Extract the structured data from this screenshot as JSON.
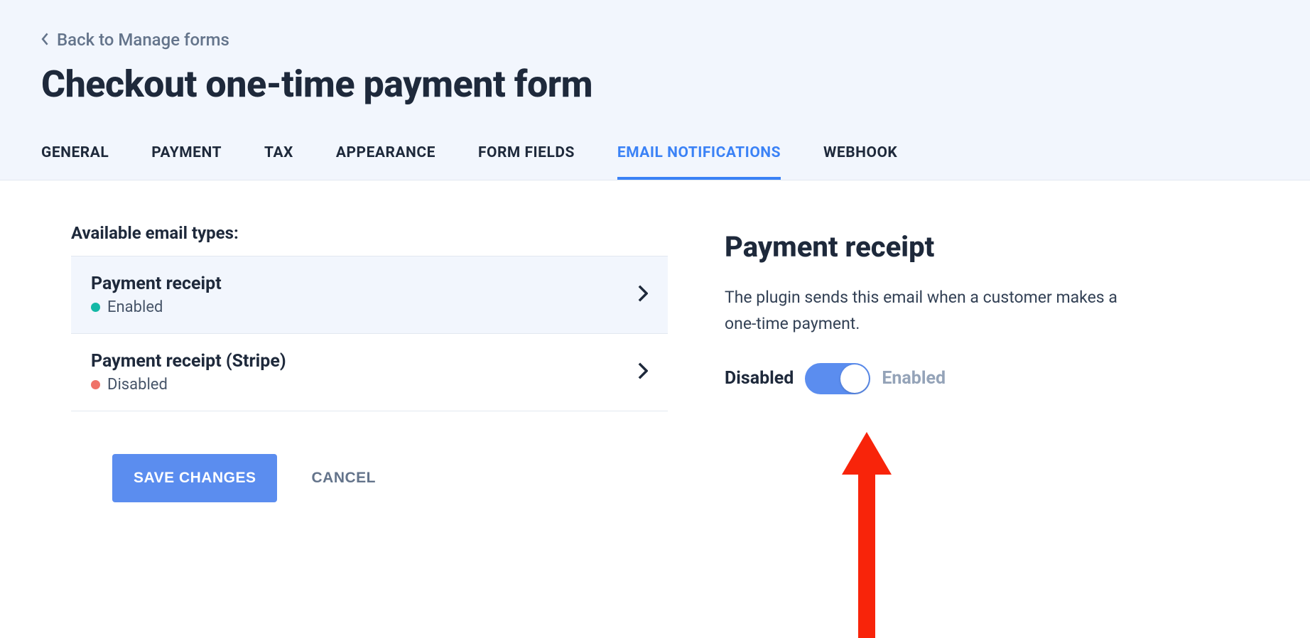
{
  "back_link": "Back to Manage forms",
  "page_title": "Checkout one-time payment form",
  "tabs": [
    {
      "label": "GENERAL",
      "active": false
    },
    {
      "label": "PAYMENT",
      "active": false
    },
    {
      "label": "TAX",
      "active": false
    },
    {
      "label": "APPEARANCE",
      "active": false
    },
    {
      "label": "FORM FIELDS",
      "active": false
    },
    {
      "label": "EMAIL NOTIFICATIONS",
      "active": true
    },
    {
      "label": "WEBHOOK",
      "active": false
    }
  ],
  "left": {
    "section_label": "Available email types:",
    "items": [
      {
        "title": "Payment receipt",
        "status_label": "Enabled",
        "status": "enabled",
        "selected": true
      },
      {
        "title": "Payment receipt (Stripe)",
        "status_label": "Disabled",
        "status": "disabled",
        "selected": false
      }
    ]
  },
  "detail": {
    "title": "Payment receipt",
    "description": "The plugin sends this email when a customer makes a one-time payment.",
    "toggle_left": "Disabled",
    "toggle_right": "Enabled",
    "toggle_on": true
  },
  "buttons": {
    "save": "SAVE CHANGES",
    "cancel": "CANCEL"
  }
}
